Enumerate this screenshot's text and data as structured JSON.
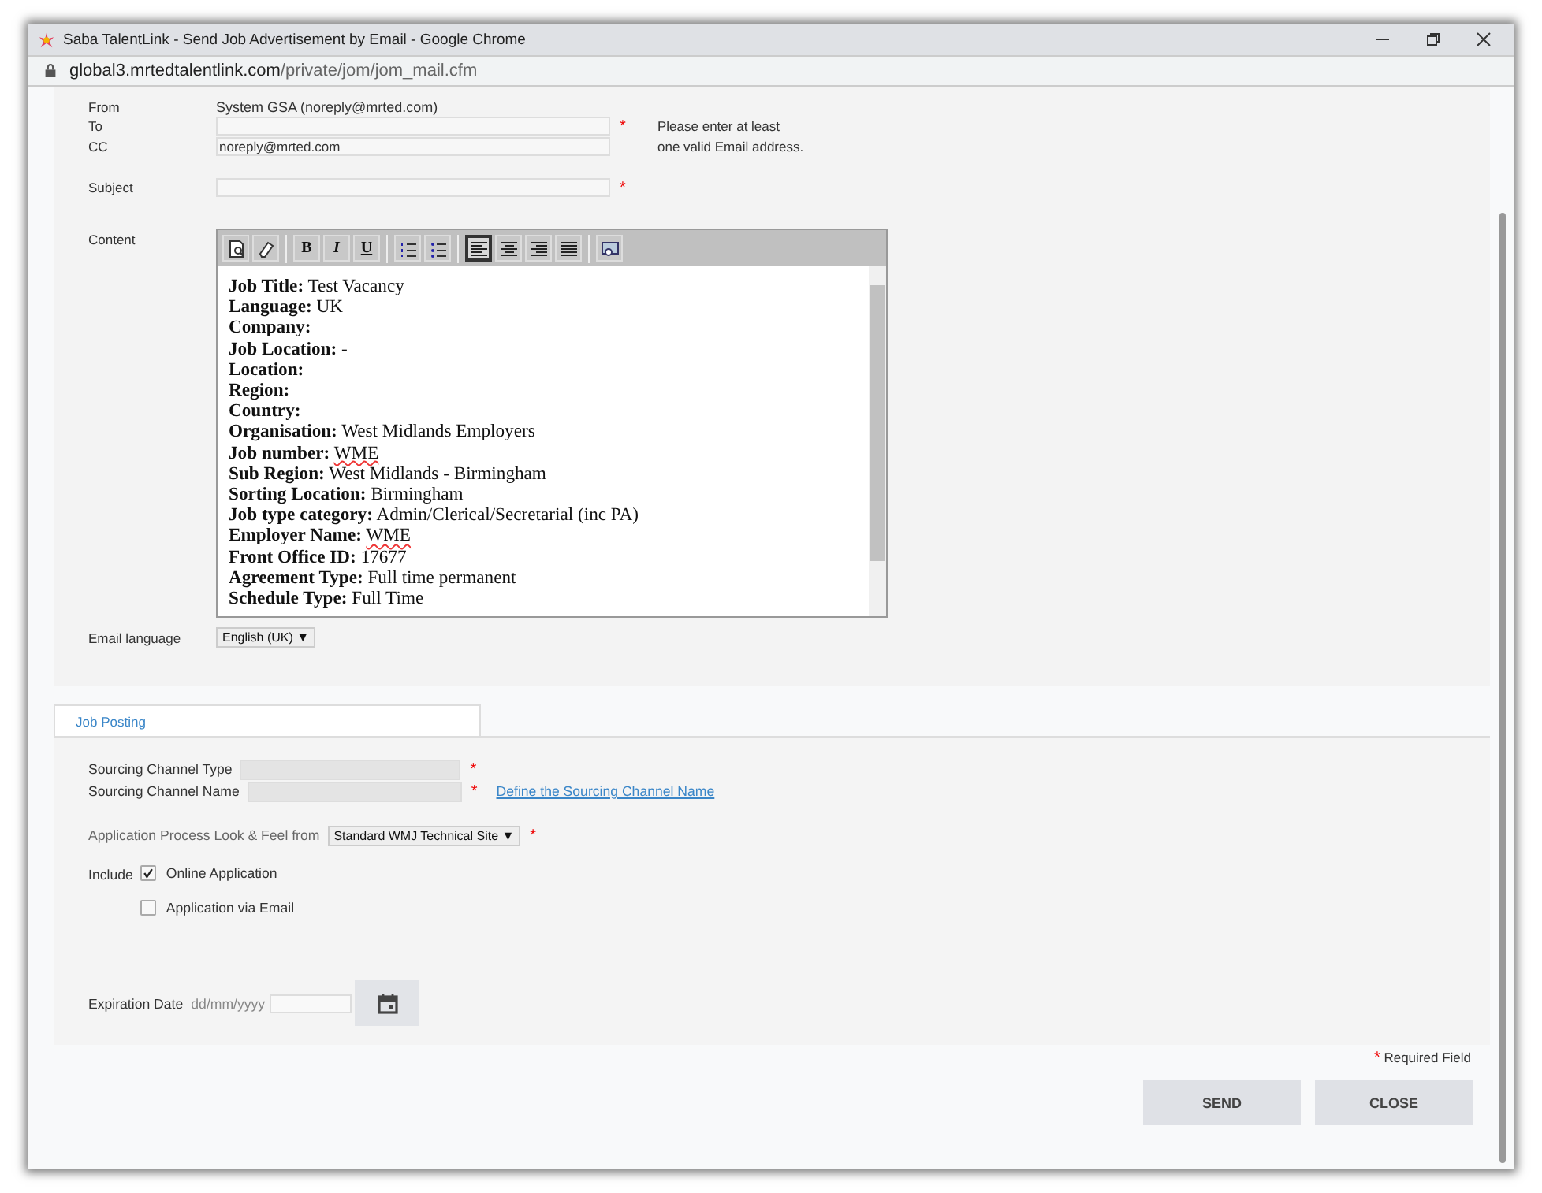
{
  "window": {
    "title": "Saba TalentLink - Send Job Advertisement by Email - Google Chrome",
    "controls": [
      {
        "kind": "minimize"
      },
      {
        "kind": "restore"
      },
      {
        "kind": "close"
      }
    ]
  },
  "address": {
    "domain": "global3.mrtedtalentlink.com",
    "path": "/private/jom/jom_mail.cfm"
  },
  "email": {
    "from": {
      "label": "From",
      "value": "System GSA (noreply@mrted.com)"
    },
    "to": {
      "label": "To",
      "required_mark": "*"
    },
    "cc": {
      "label": "CC",
      "value": "noreply@mrted.com"
    },
    "hint": [
      "Please enter at least",
      "one valid Email address."
    ],
    "subject": {
      "label": "Subject",
      "required_mark": "*"
    },
    "content_label": "Content",
    "toolbar": [
      {
        "kind": "preview",
        "selected": false
      },
      {
        "kind": "erase",
        "selected": false
      },
      {
        "kind": "sep"
      },
      {
        "kind": "bold",
        "label": "B",
        "selected": false
      },
      {
        "kind": "italic",
        "label": "I",
        "selected": false
      },
      {
        "kind": "underline",
        "label": "U",
        "selected": false
      },
      {
        "kind": "sep"
      },
      {
        "kind": "ordered-list",
        "selected": false
      },
      {
        "kind": "bullet-list",
        "selected": false
      },
      {
        "kind": "sep"
      },
      {
        "kind": "align-left",
        "selected": true
      },
      {
        "kind": "align-center",
        "selected": false
      },
      {
        "kind": "align-right",
        "selected": false
      },
      {
        "kind": "justify",
        "selected": false
      },
      {
        "kind": "sep"
      },
      {
        "kind": "image",
        "selected": false
      }
    ],
    "lines": [
      {
        "label": "Job Title:",
        "value": "Test Vacancy",
        "misspelled": false
      },
      {
        "label": "Language:",
        "value": "UK",
        "misspelled": false
      },
      {
        "label": "Company:",
        "misspelled": false
      },
      {
        "label": "Job Location:",
        "value": "-",
        "misspelled": false
      },
      {
        "label": "Location:",
        "misspelled": false
      },
      {
        "label": "Region:",
        "misspelled": false
      },
      {
        "label": "Country:",
        "misspelled": false
      },
      {
        "label": "Organisation:",
        "value": "West Midlands Employers",
        "misspelled": false
      },
      {
        "label": "Job number:",
        "value": "WME",
        "misspelled": true
      },
      {
        "label": "Sub Region:",
        "value": "West Midlands - Birmingham",
        "misspelled": false
      },
      {
        "label": "Sorting Location:",
        "value": "Birmingham",
        "misspelled": false
      },
      {
        "label": "Job type category:",
        "value": "Admin/Clerical/Secretarial (inc PA)",
        "misspelled": false
      },
      {
        "label": "Employer Name:",
        "value": "WME",
        "misspelled": true
      },
      {
        "label": "Front Office ID:",
        "value": "17677",
        "misspelled": false
      },
      {
        "label": "Agreement Type:",
        "value": "Full time permanent",
        "misspelled": false
      },
      {
        "label": "Schedule Type:",
        "value": "Full Time",
        "misspelled": false
      }
    ],
    "language": {
      "label": "Email language",
      "value": "English (UK)",
      "caret": "▼"
    }
  },
  "tabs": [
    {
      "label": "Job Posting",
      "selected": true
    }
  ],
  "posting": {
    "channel_type": {
      "label": "Sourcing Channel Type",
      "required_mark": "*"
    },
    "channel_name": {
      "label": "Sourcing Channel Name",
      "required_mark": "*",
      "link": "Define the Sourcing Channel Name"
    },
    "look_feel": {
      "label": "Application Process Look & Feel from",
      "value": "Standard WMJ Technical Site",
      "caret": "▼",
      "required_mark": "*"
    },
    "include_label": "Include",
    "include": [
      {
        "label": "Online Application",
        "checked": true
      },
      {
        "label": "Application via Email",
        "checked": false
      }
    ],
    "expiration": {
      "label": "Expiration Date",
      "placeholder": "dd/mm/yyyy"
    }
  },
  "required_note": {
    "mark": "*",
    "text": "Required Field"
  },
  "buttons": [
    {
      "label": "SEND"
    },
    {
      "label": "CLOSE"
    }
  ]
}
